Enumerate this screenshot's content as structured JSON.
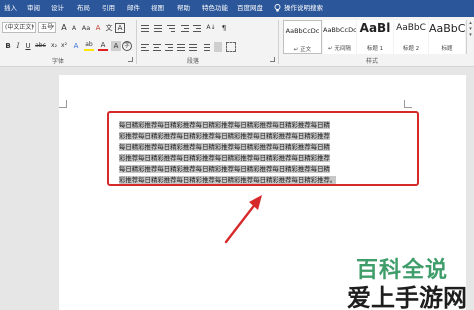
{
  "ribbon_tabs": [
    "插入",
    "审阅",
    "设计",
    "布局",
    "引用",
    "邮件",
    "视图",
    "帮助",
    "特色功能",
    "百度网盘"
  ],
  "tell_me": "操作说明搜索",
  "font": {
    "name": "(中文正文)",
    "size": "五号",
    "group_label": "字体",
    "text_label": "A",
    "bold": "B",
    "italic": "I",
    "underline": "U",
    "strike": "abc",
    "subscript": "x₂",
    "superscript": "x²",
    "grow": "A",
    "shrink": "A",
    "case": "Aa",
    "clear": "A",
    "phonetic": "文",
    "border_char": "A",
    "highlight": "ab",
    "font_color": "A",
    "shading": "A",
    "enclose": "字"
  },
  "paragraph": {
    "group_label": "段落",
    "sort": "A↓",
    "marks": "¶"
  },
  "styles": {
    "group_label": "样式",
    "items": [
      {
        "sample": "AaBbCcDc",
        "name": "↵ 正文"
      },
      {
        "sample": "AaBbCcDc",
        "name": "↵ 无间隔"
      },
      {
        "sample": "AaBl",
        "name": "标题 1"
      },
      {
        "sample": "AaBbC",
        "name": "标题 2"
      },
      {
        "sample": "AaBbC",
        "name": "标题"
      }
    ]
  },
  "document": {
    "lines": [
      "每日精彩推荐每日精彩推荐每日精彩推荐每日精彩推荐每日精彩推荐每日精",
      "彩推荐每日精彩推荐每日精彩推荐每日精彩推荐每日精彩推荐每日精彩推荐",
      "每日精彩推荐每日精彩推荐每日精彩推荐每日精彩推荐每日精彩推荐每日精",
      "彩推荐每日精彩推荐每日精彩推荐每日精彩推荐每日精彩推荐每日精彩推荐",
      "每日精彩推荐每日精彩推荐每日精彩推荐每日精彩推荐每日精彩推荐每日精",
      "彩推荐每日精彩推荐每日精彩推荐每日精彩推荐每日精彩推荐每日精彩推荐。"
    ]
  },
  "watermark": {
    "line1": "百科全说",
    "line2": "爱上手游网"
  },
  "colors": {
    "ribbon_blue": "#2b579a",
    "annotation_red": "#d62a2a",
    "selection_gray": "#c7c7c7",
    "watermark_green": "#3f9d6a"
  }
}
